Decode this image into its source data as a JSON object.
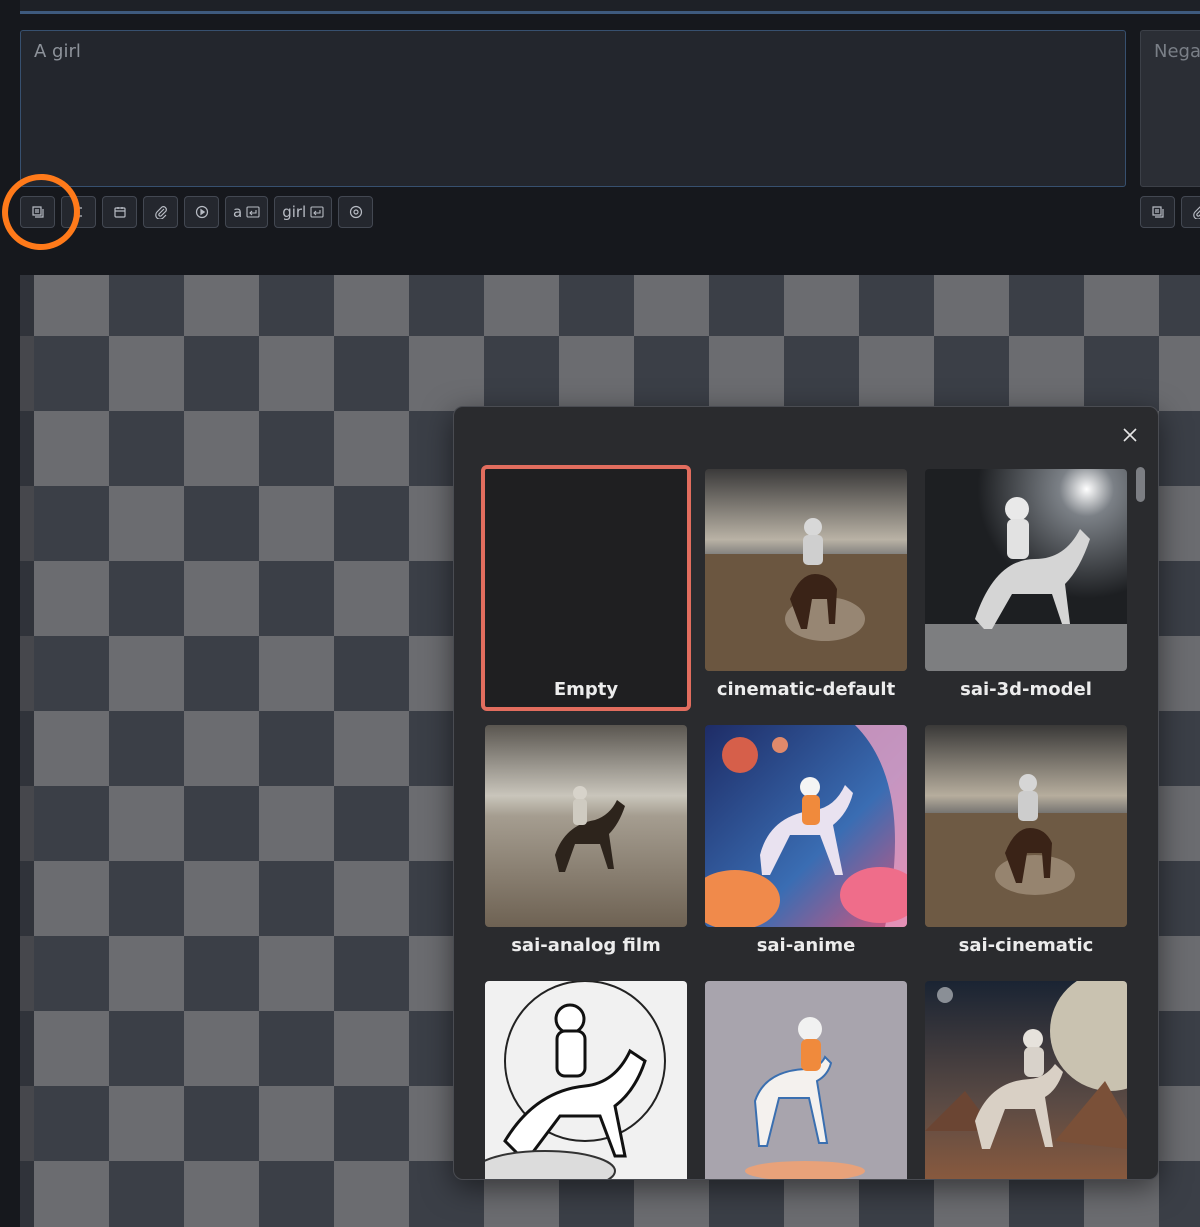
{
  "prompt": {
    "value": "A girl"
  },
  "negative_prompt": {
    "placeholder": "Nega"
  },
  "toolbar": {
    "buttons": [
      {
        "icon": "styles-icon"
      },
      {
        "icon": "wildcard-icon"
      },
      {
        "icon": "calendar-icon"
      },
      {
        "icon": "paperclip-icon"
      },
      {
        "icon": "play-icon"
      },
      {
        "label": "a",
        "icon": "enter-icon"
      },
      {
        "label": "girl",
        "icon": "enter-icon"
      },
      {
        "icon": "record-icon"
      }
    ]
  },
  "styles_modal": {
    "items": [
      {
        "label": "Empty",
        "selected": true
      },
      {
        "label": "cinematic-default"
      },
      {
        "label": "sai-3d-model"
      },
      {
        "label": "sai-analog film"
      },
      {
        "label": "sai-anime"
      },
      {
        "label": "sai-cinematic"
      },
      {
        "label": ""
      },
      {
        "label": ""
      },
      {
        "label": ""
      }
    ]
  },
  "colors": {
    "annotation": "#ff7a1a",
    "selection_border": "#e26d5e",
    "prompt_border": "#37506f"
  }
}
